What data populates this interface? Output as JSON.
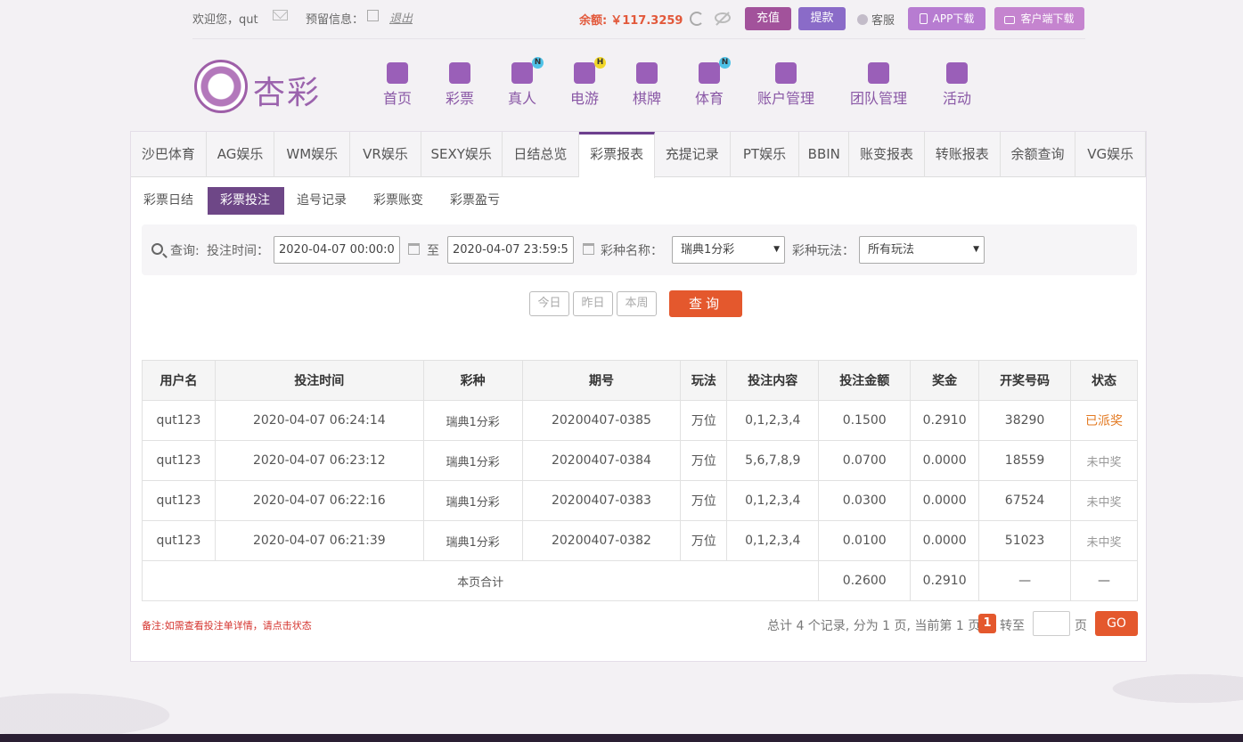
{
  "topbar": {
    "welcome": "欢迎您，qut",
    "reserved_label": "预留信息：",
    "logout": "退出",
    "balance_label": "余额:",
    "balance_value": "￥117.3259",
    "recharge": "充值",
    "withdraw": "提款",
    "service": "客服",
    "app_download": "APP下载",
    "client_download": "客户端下载"
  },
  "logo": {
    "text": "杏彩"
  },
  "mainnav": [
    {
      "label": "首页",
      "icon": "home-icon",
      "badge": ""
    },
    {
      "label": "彩票",
      "icon": "lottery-icon",
      "badge": ""
    },
    {
      "label": "真人",
      "icon": "live-dealer-icon",
      "badge": "N"
    },
    {
      "label": "电游",
      "icon": "gamepad-icon",
      "badge": "H"
    },
    {
      "label": "棋牌",
      "icon": "cards-icon",
      "badge": ""
    },
    {
      "label": "体育",
      "icon": "trophy-icon",
      "badge": "N"
    },
    {
      "label": "账户管理",
      "icon": "yen-coin-icon",
      "badge": ""
    },
    {
      "label": "团队管理",
      "icon": "team-icon",
      "badge": ""
    },
    {
      "label": "活动",
      "icon": "gift-icon",
      "badge": ""
    }
  ],
  "tabs": [
    {
      "label": "沙巴体育"
    },
    {
      "label": "AG娱乐"
    },
    {
      "label": "WM娱乐"
    },
    {
      "label": "VR娱乐"
    },
    {
      "label": "SEXY娱乐"
    },
    {
      "label": "日结总览"
    },
    {
      "label": "彩票报表"
    },
    {
      "label": "充提记录"
    },
    {
      "label": "PT娱乐"
    },
    {
      "label": "BBIN"
    },
    {
      "label": "账变报表"
    },
    {
      "label": "转账报表"
    },
    {
      "label": "余额查询"
    },
    {
      "label": "VG娱乐"
    }
  ],
  "active_tab": "彩票报表",
  "subtabs": [
    {
      "label": "彩票日结"
    },
    {
      "label": "彩票投注"
    },
    {
      "label": "追号记录"
    },
    {
      "label": "彩票账变"
    },
    {
      "label": "彩票盈亏"
    }
  ],
  "active_subtab": "彩票投注",
  "search": {
    "query_label": "查询:",
    "bet_time_label": "投注时间：",
    "start_time": "2020-04-07 00:00:00",
    "to_label": "至",
    "end_time": "2020-04-07 23:59:59",
    "lottery_name_label": "彩种名称：",
    "lottery_name_value": "瑞典1分彩",
    "play_type_label": "彩种玩法：",
    "play_type_value": "所有玩法",
    "today": "今日",
    "yesterday": "昨日",
    "this_week": "本周",
    "query_button": "查询"
  },
  "table": {
    "headers": [
      "用户名",
      "投注时间",
      "彩种",
      "期号",
      "玩法",
      "投注内容",
      "投注金额",
      "奖金",
      "开奖号码",
      "状态"
    ],
    "rows": [
      [
        "qut123",
        "2020-04-07 06:24:14",
        "瑞典1分彩",
        "20200407-0385",
        "万位",
        "0,1,2,3,4",
        "0.1500",
        "0.2910",
        "38290",
        "已派奖"
      ],
      [
        "qut123",
        "2020-04-07 06:23:12",
        "瑞典1分彩",
        "20200407-0384",
        "万位",
        "5,6,7,8,9",
        "0.0700",
        "0.0000",
        "18559",
        "未中奖"
      ],
      [
        "qut123",
        "2020-04-07 06:22:16",
        "瑞典1分彩",
        "20200407-0383",
        "万位",
        "0,1,2,3,4",
        "0.0300",
        "0.0000",
        "67524",
        "未中奖"
      ],
      [
        "qut123",
        "2020-04-07 06:21:39",
        "瑞典1分彩",
        "20200407-0382",
        "万位",
        "0,1,2,3,4",
        "0.0100",
        "0.0000",
        "51023",
        "未中奖"
      ]
    ],
    "total_label": "本页合计",
    "total_amount": "0.2600",
    "total_prize": "0.2910",
    "total_number": "—",
    "total_status": "—"
  },
  "footer": {
    "remark": "备注:如需查看投注单详情，请点击状态",
    "pager_info": "总计 4 个记录, 分为 1 页, 当前第 1 页",
    "current_page": "1",
    "goto_label": "转至",
    "page_unit": "页",
    "go_button": "GO"
  },
  "colors": {
    "brand_purple": "#6d3f8e",
    "accent_orange": "#e4582d",
    "won_status": "#e37a22"
  }
}
